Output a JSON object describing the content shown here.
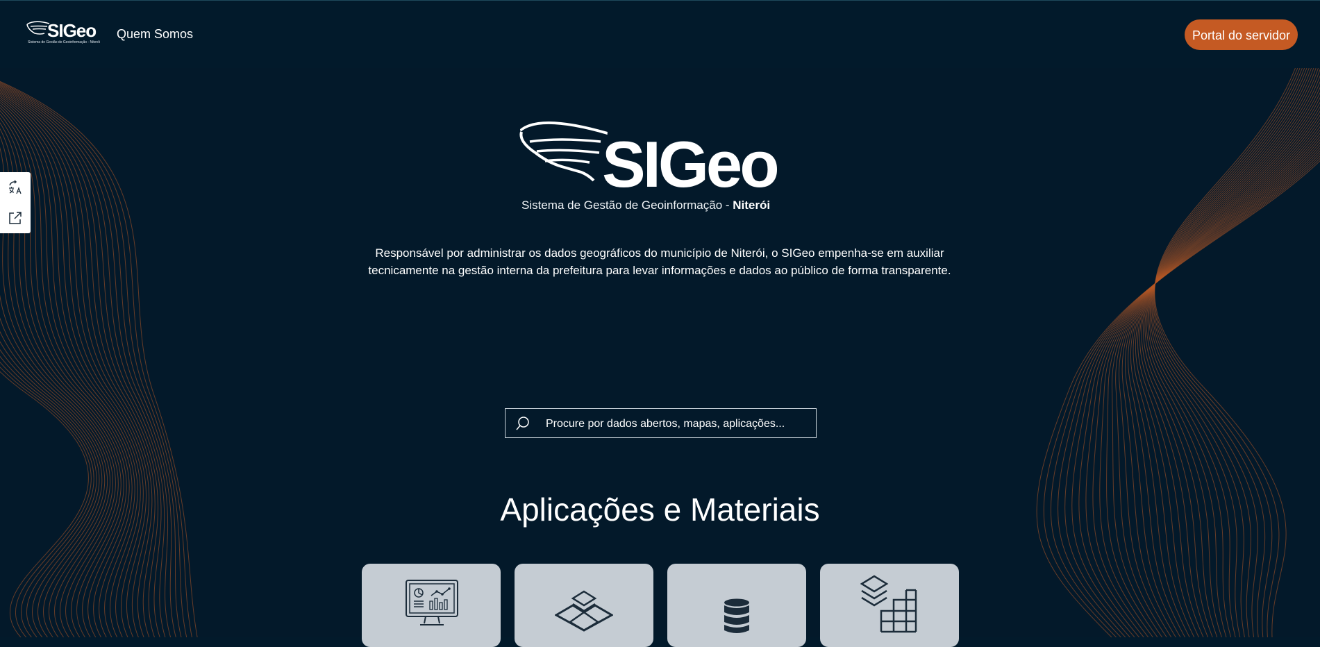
{
  "header": {
    "brand_word": "SIGeo",
    "brand_sub": "Sistema de Gestão de Geoinformação - Niterói",
    "nav_about": "Quem Somos",
    "portal_button": "Portal do servidor"
  },
  "side_tools": {
    "translate_icon": "translate-icon",
    "share_icon": "share-icon"
  },
  "hero": {
    "logo_word": "SIGeo",
    "logo_sub_prefix": "Sistema de Gestão de Geoinformação - ",
    "logo_sub_city": "Niterói",
    "description": "Responsável por administrar os dados geográficos do município de Niterói, o SIGeo empenha-se em auxiliar tecnicamente na gestão interna da prefeitura para levar informações e dados ao público de forma transparente."
  },
  "search": {
    "placeholder": "Procure por dados abertos, mapas, aplicações..."
  },
  "section": {
    "title": "Aplicações e Materiais",
    "cards": [
      {
        "icon": "dashboard-monitor-icon"
      },
      {
        "icon": "map-layers-icon"
      },
      {
        "icon": "database-icon"
      },
      {
        "icon": "layers-grid-icon"
      }
    ]
  },
  "colors": {
    "background": "#021a2b",
    "accent": "#c55a23",
    "card": "#c5ccd3"
  }
}
